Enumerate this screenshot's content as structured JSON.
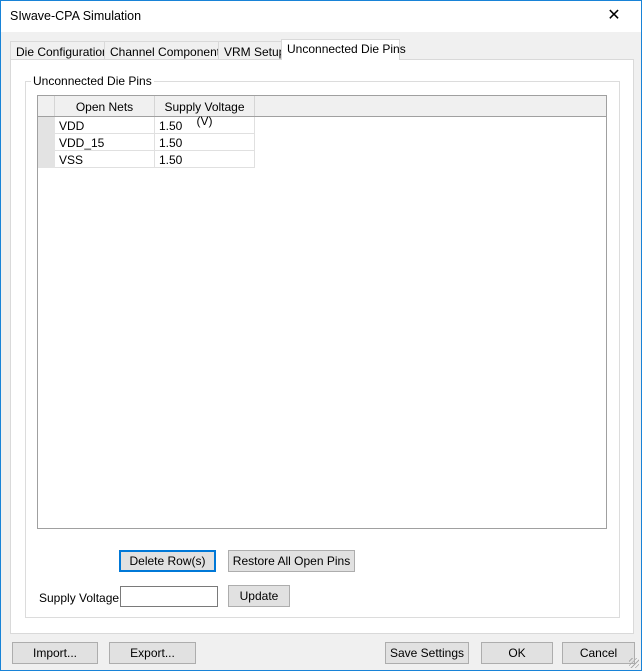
{
  "window": {
    "title": "SIwave-CPA Simulation",
    "close_icon": "close-icon"
  },
  "tabs": [
    {
      "label": "Die Configuration"
    },
    {
      "label": "Channel Components"
    },
    {
      "label": "VRM Setup"
    },
    {
      "label": "Unconnected Die Pins",
      "active": true
    }
  ],
  "group": {
    "label": "Unconnected Die Pins"
  },
  "table": {
    "columns": [
      "Open Nets",
      "Supply Voltage (V)"
    ],
    "rows": [
      [
        "VDD",
        "1.50"
      ],
      [
        "VDD_15",
        "1.50"
      ],
      [
        "VSS",
        "1.50"
      ]
    ]
  },
  "actions": {
    "delete": "Delete Row(s)",
    "restore": "Restore All Open Pins"
  },
  "supply": {
    "label": "Supply Voltage:",
    "value": "",
    "update": "Update"
  },
  "footer": {
    "import": "Import...",
    "export": "Export...",
    "save": "Save Settings",
    "ok": "OK",
    "cancel": "Cancel"
  }
}
